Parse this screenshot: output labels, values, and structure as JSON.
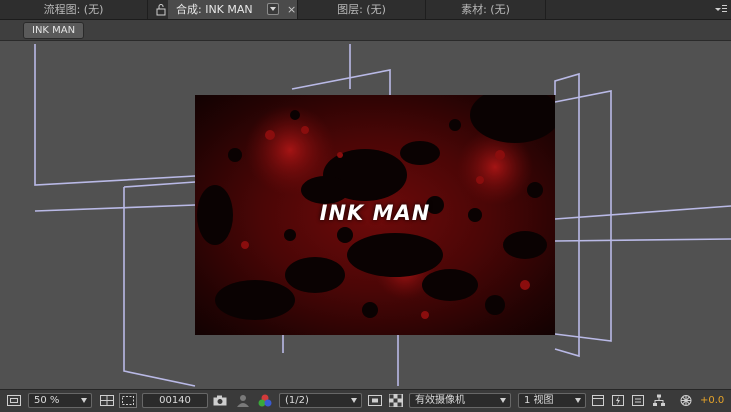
{
  "tabs": [
    {
      "label": "流程图: (无)"
    },
    {
      "label": "合成: INK MAN"
    },
    {
      "label": "图层: (无)"
    },
    {
      "label": "素材: (无)"
    }
  ],
  "tab_close_glyph": "×",
  "breadcrumb": {
    "label": "INK MAN"
  },
  "composition": {
    "title": "INK MAN"
  },
  "toolbar": {
    "zoom": "50 %",
    "timecode": "00140",
    "resolution": "(1/2)",
    "camera": "有效摄像机",
    "views": "1 视图",
    "exposure": "+0.0"
  },
  "colors": {
    "wire": "#b9b9e6",
    "exposure": "#e6a42a"
  }
}
